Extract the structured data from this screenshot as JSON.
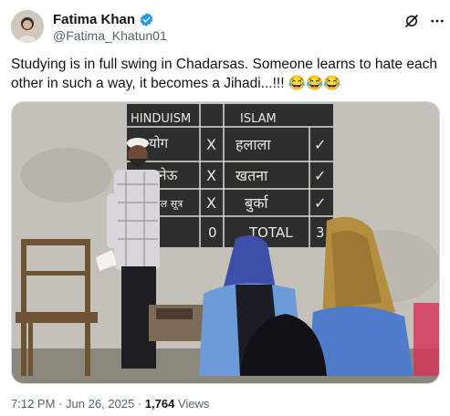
{
  "author": {
    "name": "Fatima Khan",
    "handle": "@Fatima_Khatun01",
    "verified": true
  },
  "post": {
    "text": "Studying is in full swing in Chadarsas. Someone learns to hate each other in such a way, it becomes a Jihadi...!!! 😂😂😂"
  },
  "board": {
    "col1_header": "HINDUISM",
    "col2_header": "ISLAM",
    "rows": [
      {
        "left": "योग",
        "mark": "X",
        "right": "हलाला",
        "check": "✓"
      },
      {
        "left": "जनेऊ",
        "mark": "X",
        "right": "खतना",
        "check": "✓"
      },
      {
        "left": "मंगल सूत्र",
        "mark": "X",
        "right": "बुर्का",
        "check": "✓"
      }
    ],
    "total_left": "0",
    "total_label": "TOTAL",
    "total_right": "3"
  },
  "meta": {
    "time": "7:12 PM",
    "separator": "·",
    "date": "Jun 26, 2025",
    "views_count": "1,764",
    "views_label": "Views"
  },
  "icons": {
    "verified": "verified-badge-icon",
    "grok": "grok-icon",
    "more": "more-options-icon"
  },
  "colors": {
    "verified": "#1d9bf0",
    "muted": "#536471",
    "text": "#0f1419"
  }
}
